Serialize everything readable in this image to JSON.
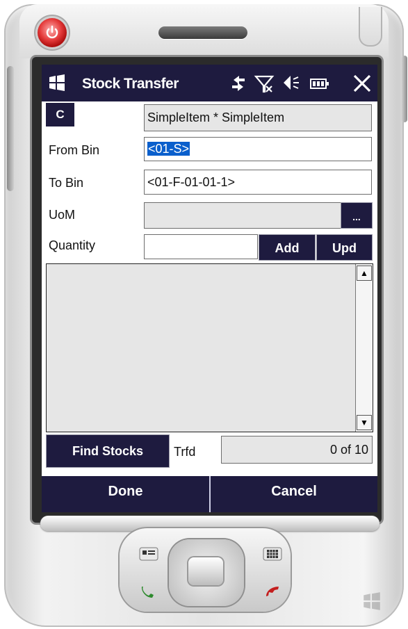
{
  "app": {
    "title": "Stock Transfer"
  },
  "item_row": {
    "c_label": "C",
    "item_value": "SimpleItem * SimpleItem"
  },
  "from_bin": {
    "label": "From Bin",
    "value": "<01-S>"
  },
  "to_bin": {
    "label": "To Bin",
    "value": "<01-F-01-01-1>"
  },
  "uom": {
    "label": "UoM",
    "value": "",
    "browse_label": "..."
  },
  "quantity": {
    "label": "Quantity",
    "value": "",
    "add_label": "Add",
    "upd_label": "Upd"
  },
  "transfer_list": {
    "items": []
  },
  "find_stocks": {
    "label": "Find Stocks"
  },
  "trfd": {
    "label": "Trfd",
    "value": "0 of 10"
  },
  "footer": {
    "done_label": "Done",
    "cancel_label": "Cancel"
  },
  "colors": {
    "navy": "#1e1b3f",
    "selection": "#0a5fcc",
    "field_gray": "#e6e6e6"
  },
  "icons": [
    "power-icon",
    "windows-start-icon",
    "data-connection-icon",
    "no-signal-icon",
    "volume-icon",
    "battery-icon",
    "close-icon",
    "scroll-up-icon",
    "scroll-down-icon",
    "contacts-icon",
    "calendar-icon",
    "call-icon",
    "end-call-icon"
  ]
}
